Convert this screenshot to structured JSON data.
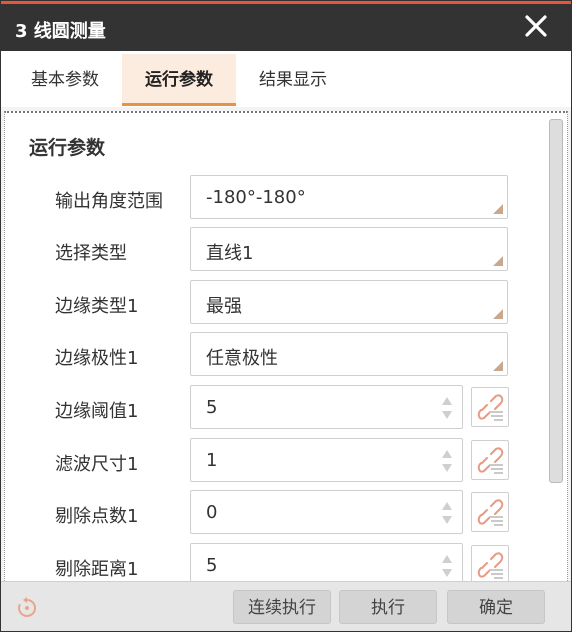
{
  "window": {
    "title": "3 线圆测量"
  },
  "tabs": [
    {
      "label": "基本参数",
      "active": false
    },
    {
      "label": "运行参数",
      "active": true
    },
    {
      "label": "结果显示",
      "active": false
    }
  ],
  "section": {
    "title": "运行参数"
  },
  "fields": [
    {
      "label": "输出角度范围",
      "value": "-180°-180°"
    },
    {
      "label": "选择类型",
      "value": "直线1"
    },
    {
      "label": "边缘类型1",
      "value": "最强"
    },
    {
      "label": "边缘极性1",
      "value": "任意极性"
    },
    {
      "label": "边缘阈值1",
      "value": "5"
    },
    {
      "label": "滤波尺寸1",
      "value": "1"
    },
    {
      "label": "剔除点数1",
      "value": "0"
    },
    {
      "label": "剔除距离1",
      "value": "5"
    }
  ],
  "footer": {
    "continuous_label": "连续执行",
    "execute_label": "执行",
    "confirm_label": "确定"
  },
  "colors": {
    "accent": "#e89245",
    "titlebar": "#333333",
    "title_stripe": "#e8553b"
  },
  "icons": {
    "close": "close-icon",
    "refresh": "refresh-icon",
    "link": "link-icon",
    "spin": "spinner-arrows-icon"
  }
}
